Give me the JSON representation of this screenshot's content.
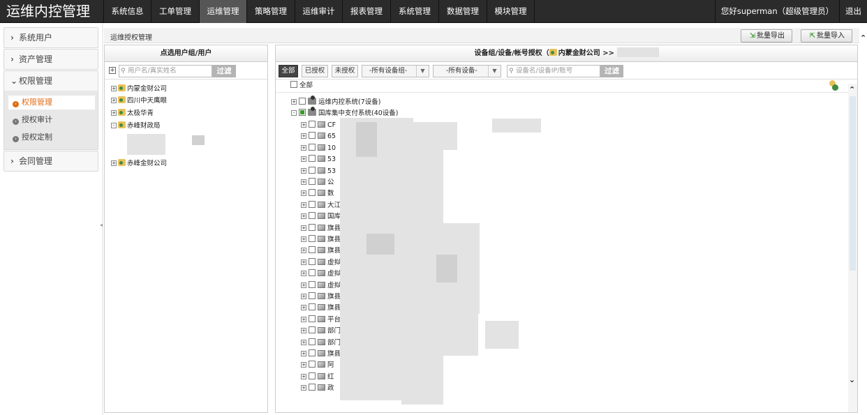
{
  "app": {
    "title": "运维内控管理"
  },
  "nav": {
    "items": [
      "系统信息",
      "工单管理",
      "运维管理",
      "策略管理",
      "运维审计",
      "报表管理",
      "系统管理",
      "数据管理",
      "模块管理"
    ],
    "active": "运维管理",
    "greeting": "您好superman（超级管理员）",
    "logout": "退出"
  },
  "sidebar": {
    "groups": [
      {
        "label": "系统用户"
      },
      {
        "label": "资产管理"
      },
      {
        "label": "权限管理"
      },
      {
        "label": "会同管理"
      }
    ],
    "perm_items": [
      "权限管理",
      "授权审计",
      "授权定制"
    ]
  },
  "header": {
    "title": "运维授权管理",
    "export_label": "批量导出",
    "import_label": "批量导入"
  },
  "left_panel": {
    "title": "点选用户组/用户",
    "search_placeholder": "用户名/真实姓名",
    "filter_label": "过滤",
    "expand_symbol": "+",
    "tree": [
      {
        "label": "内蒙金财公司",
        "sign": "+"
      },
      {
        "label": "四川中天鹰眼",
        "sign": "+"
      },
      {
        "label": "太极华青",
        "sign": "+"
      },
      {
        "label": "赤峰财政局",
        "sign": "-"
      },
      {
        "label": "赤峰金财公司",
        "sign": "+"
      }
    ]
  },
  "right_panel": {
    "title_prefix": "设备组/设备/帐号授权（",
    "title_group": "内蒙金财公司",
    "title_suffix": ">>",
    "tabs": [
      "全部",
      "已授权",
      "未授权"
    ],
    "group_select": "-所有设备组-",
    "device_select": "-所有设备-",
    "search_placeholder": "设备名/设备IP/账号",
    "filter_label": "过滤",
    "select_all": "全部",
    "systems": [
      {
        "label": "运维内控系统(7设备)",
        "sign": "+"
      },
      {
        "label": "国库集中支付系统(40设备)",
        "sign": "-"
      }
    ],
    "devices": [
      "CF",
      "65",
      "10",
      "53",
      "53",
      "公",
      "数",
      "大江",
      "国库",
      "旗县",
      "旗县",
      "旗县",
      "虚拟",
      "虚拟",
      "虚拟",
      "旗县",
      "旗县",
      "平台",
      "部门",
      "部门",
      "旗县",
      "阿",
      "红",
      "政"
    ]
  }
}
